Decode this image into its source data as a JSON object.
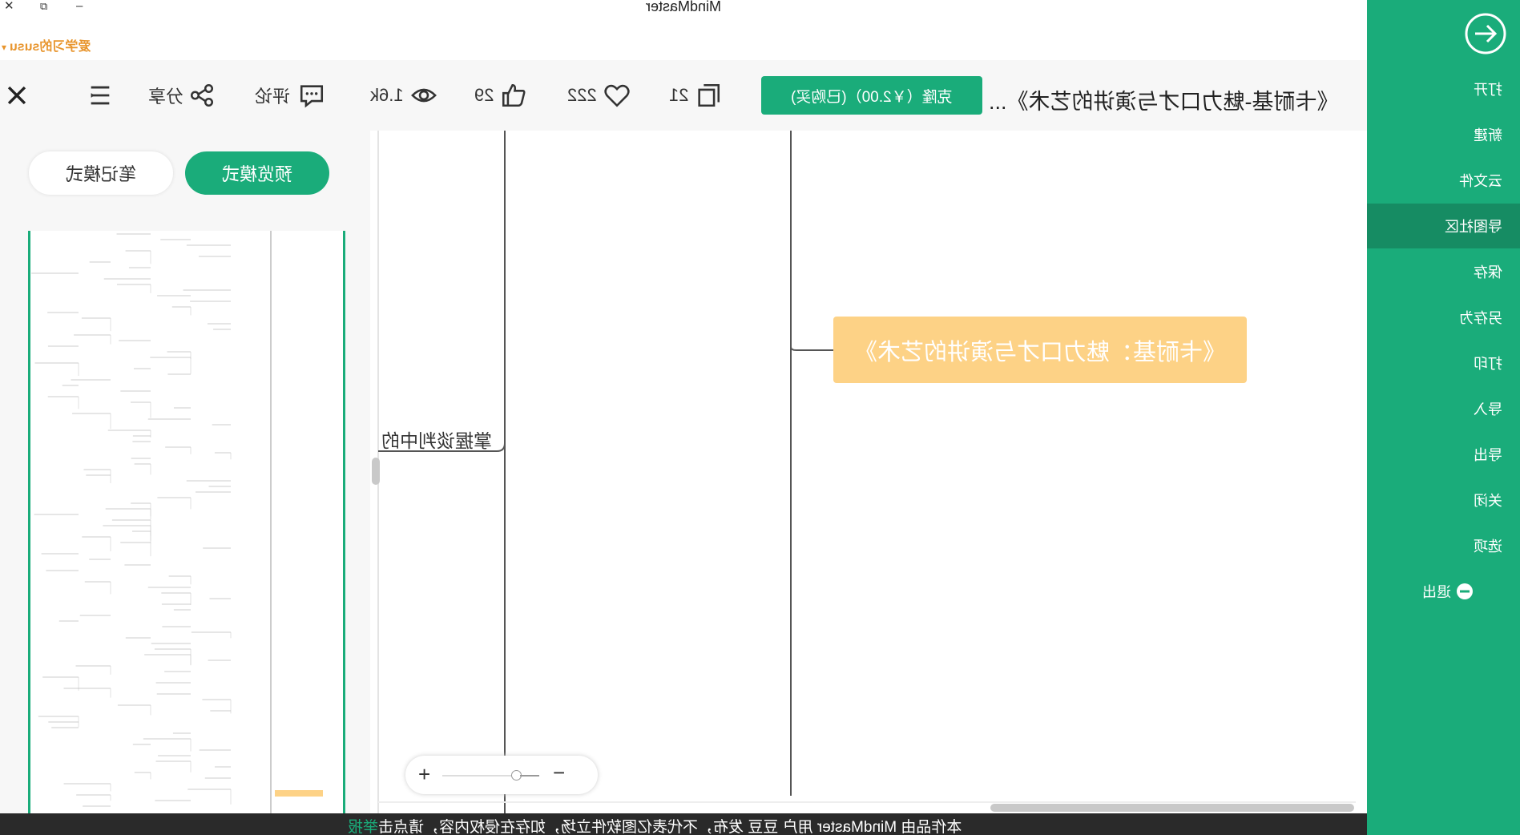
{
  "window": {
    "title": "MindMaster",
    "minimize_glyph": "–",
    "restore_glyph": "⧉",
    "close_glyph": "✕"
  },
  "user": {
    "name": "爱学习的susu",
    "dropdown_glyph": "▾"
  },
  "toolbar": {
    "doc_title": "《卡耐基-魅力口才与演讲的艺术》...",
    "clone_button": "克隆（￥2.00）(已购买)",
    "copies_count": "21",
    "favorites_count": "222",
    "likes_count": "29",
    "views_count": "1.6k",
    "comment_label": "评论",
    "share_label": "分享",
    "icons": [
      "copy-icon",
      "heart-icon",
      "thumbs-up-icon",
      "eye-icon",
      "comment-icon",
      "share-icon",
      "menu-icon",
      "close-icon"
    ]
  },
  "sidebar": {
    "items": [
      {
        "label": "打开"
      },
      {
        "label": "新建"
      },
      {
        "label": "云文件"
      },
      {
        "label": "导图社区",
        "active": true
      },
      {
        "label": "保存"
      },
      {
        "label": "另存为"
      },
      {
        "label": "打印"
      },
      {
        "label": "导入"
      },
      {
        "label": "导出"
      },
      {
        "label": "关闭"
      },
      {
        "label": "选项"
      },
      {
        "label": "退出"
      }
    ]
  },
  "left_panel": {
    "preview_mode": "预览模式",
    "note_mode": "笔记模式"
  },
  "canvas": {
    "root_topic": "《卡耐基：魅力口才与演讲的艺术》",
    "branch_topic": "掌握谈判中的"
  },
  "zoom": {
    "plus": "+",
    "minus": "−"
  },
  "footer": {
    "text": "本作品由 MindMaster 用户 豆豆 发布，不代表亿图软件立场，如存在侵权内容，请点击",
    "link": "举报"
  },
  "colors": {
    "brand_green": "#1aac7a",
    "sidebar_active": "#168c63",
    "root_node": "#fdd286",
    "user_orange": "#e8952d"
  }
}
